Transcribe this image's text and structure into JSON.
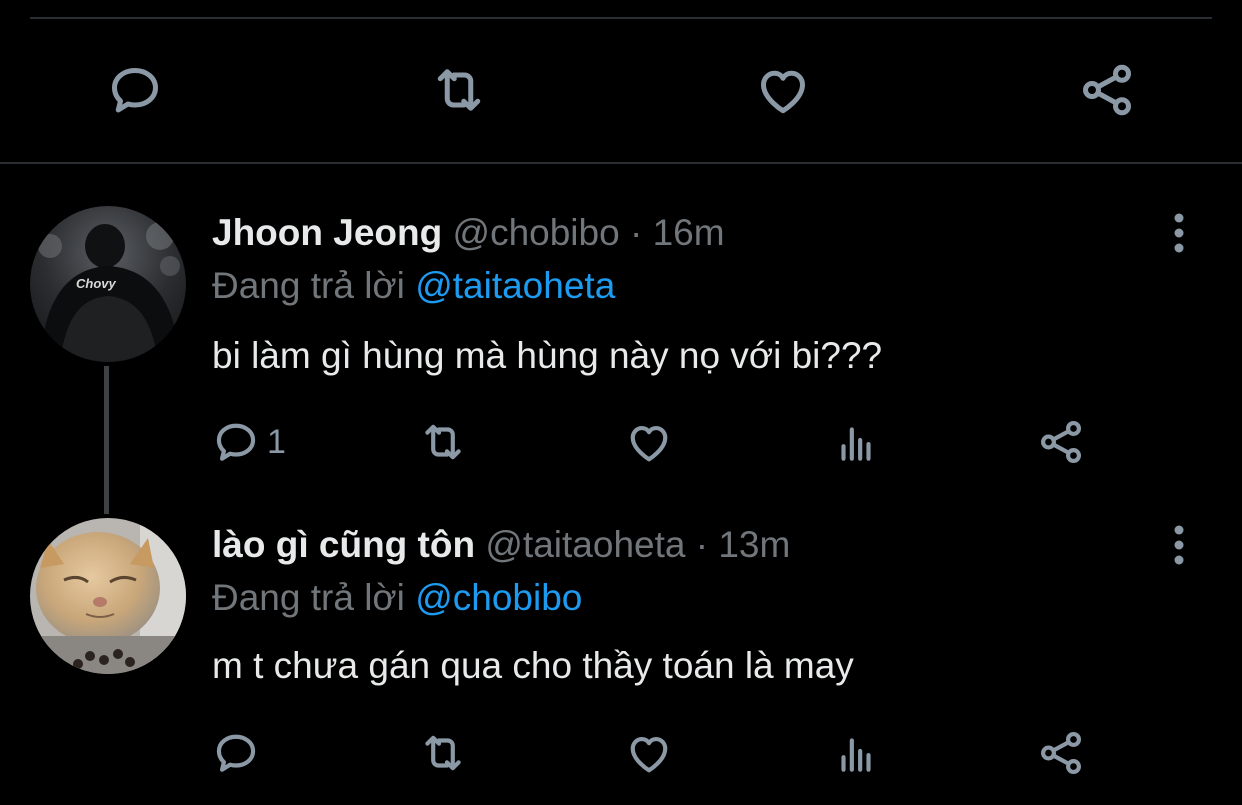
{
  "main_tweet": {
    "actions": [
      {
        "name": "reply",
        "icon": "reply-icon"
      },
      {
        "name": "retweet",
        "icon": "retweet-icon"
      },
      {
        "name": "like",
        "icon": "heart-icon"
      },
      {
        "name": "share",
        "icon": "share-icon"
      }
    ]
  },
  "replies": [
    {
      "display_name": "Jhoon Jeong",
      "handle": "@chobibo",
      "separator": "·",
      "time": "16m",
      "reply_prefix": "Đang trả lời",
      "reply_to": "@taitaoheta",
      "text": "bi làm gì hùng mà hùng này nọ với bi???",
      "reply_count": "1",
      "avatar_text": "Chovy"
    },
    {
      "display_name": "lào gì cũng tôn",
      "handle": "@taitaoheta",
      "separator": "·",
      "time": "13m",
      "reply_prefix": "Đang trả lời",
      "reply_to": "@chobibo",
      "text": "m t chưa gán qua cho thầy toán là may",
      "reply_count": ""
    }
  ],
  "colors": {
    "background": "#000000",
    "text_primary": "#e7e9ea",
    "text_secondary": "#71767b",
    "accent_link": "#1d9bf0",
    "icon": "#8b98a5",
    "divider": "#2a2d31"
  }
}
